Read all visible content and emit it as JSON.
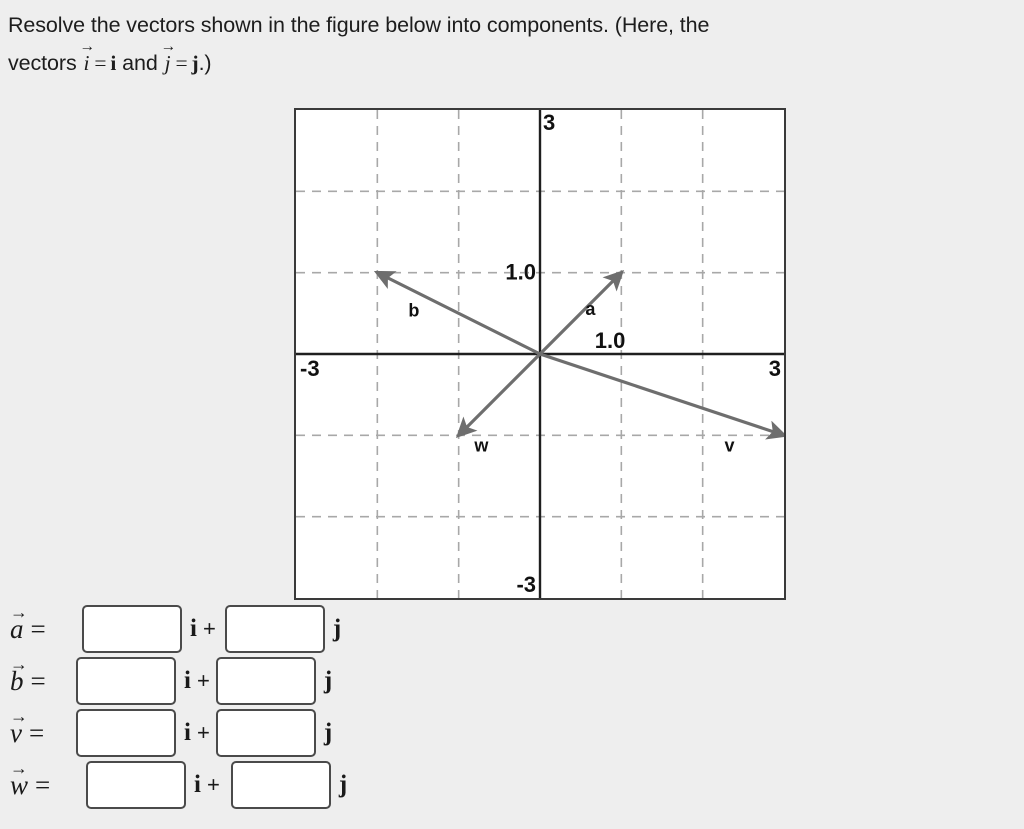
{
  "prompt": {
    "line1": "Resolve the vectors shown in the figure below into components. (Here, the",
    "line2_pre": "vectors",
    "line2_i_italic": "i",
    "line2_eq1": "=",
    "line2_i_bold": "i",
    "line2_and": "and",
    "line2_j_italic": "j",
    "line2_eq2": "=",
    "line2_j_bold": "j",
    "line2_end": ".)",
    "arrow_glyph": "→"
  },
  "chart_data": {
    "type": "scatter",
    "title": "",
    "xlabel": "",
    "ylabel": "",
    "xlim": [
      -3,
      3
    ],
    "ylim": [
      -3,
      3
    ],
    "grid": true,
    "grid_step": 1,
    "legend": "none",
    "tick_labels": {
      "x_right": "3",
      "x_left": "-3",
      "x_unit": "1.0",
      "y_top": "3",
      "y_bottom": "-3",
      "y_unit": "1.0"
    },
    "vectors": [
      {
        "name": "a",
        "label": "a",
        "tail": [
          0,
          0
        ],
        "head": [
          1,
          1
        ],
        "label_pos": [
          0.62,
          0.48
        ]
      },
      {
        "name": "b",
        "label": "b",
        "tail": [
          0,
          0
        ],
        "head": [
          -2,
          1
        ],
        "label_pos": [
          -1.55,
          0.46
        ]
      },
      {
        "name": "v",
        "label": "v",
        "tail": [
          0,
          0
        ],
        "head": [
          3,
          -1
        ],
        "label_pos": [
          2.33,
          -1.2
        ]
      },
      {
        "name": "w",
        "label": "w",
        "tail": [
          0,
          0
        ],
        "head": [
          -1,
          -1
        ],
        "label_pos": [
          -0.72,
          -1.2
        ]
      }
    ],
    "colors": {
      "vector": "#6e6e6e",
      "axis": "#1f1f1f",
      "grid": "#a8a8a8",
      "plot_bg": "#ffffff",
      "border": "#3a3a3a"
    }
  },
  "answers": {
    "unit_i": "i",
    "unit_j": "j",
    "plus": "+",
    "equals": "=",
    "arrow_glyph": "→",
    "rows": [
      {
        "key": "a",
        "symbol": "a",
        "i_value": "",
        "j_value": "",
        "i_placeholder": "",
        "j_placeholder": ""
      },
      {
        "key": "b",
        "symbol": "b",
        "i_value": "",
        "j_value": "",
        "i_placeholder": "",
        "j_placeholder": ""
      },
      {
        "key": "v",
        "symbol": "v",
        "i_value": "",
        "j_value": "",
        "i_placeholder": "",
        "j_placeholder": ""
      },
      {
        "key": "w",
        "symbol": "w",
        "i_value": "",
        "j_value": "",
        "i_placeholder": "",
        "j_placeholder": ""
      }
    ]
  }
}
